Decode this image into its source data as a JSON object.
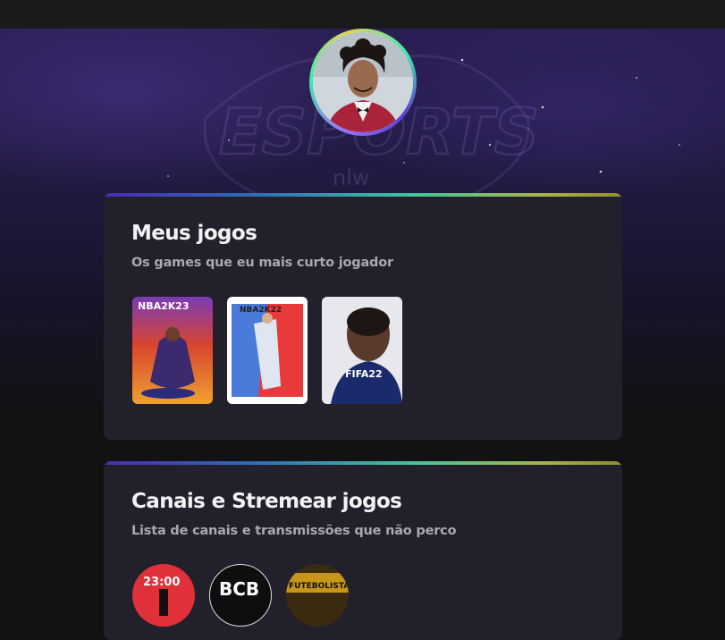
{
  "profile": {
    "avatar_icon": "profile-photo"
  },
  "hero": {
    "logo_text": "ESPORTS",
    "logo_sub": "nlw"
  },
  "games_section": {
    "title": "Meus jogos",
    "subtitle": "Os games que eu mais curto jogador",
    "games": [
      {
        "name": "NBA 2K23",
        "cover_label": "NBA2K23"
      },
      {
        "name": "NBA 2K22",
        "cover_label": "NBA2K22"
      },
      {
        "name": "FIFA 22",
        "cover_label": "FIFA22"
      }
    ]
  },
  "channels_section": {
    "title": "Canais e Stremear jogos",
    "subtitle": "Lista de canais e transmissões que não perco",
    "channels": [
      {
        "name": "23:00",
        "color": "#e0303a"
      },
      {
        "name": "BCB",
        "color": "#0e0e0e"
      },
      {
        "name": "FUTEBOLISTA",
        "color": "#3a2a10"
      }
    ]
  },
  "colors": {
    "accent_purple": "#9572fc",
    "accent_green": "#43e7ad",
    "accent_yellow": "#e2d45c",
    "card_bg": "#22202b"
  }
}
